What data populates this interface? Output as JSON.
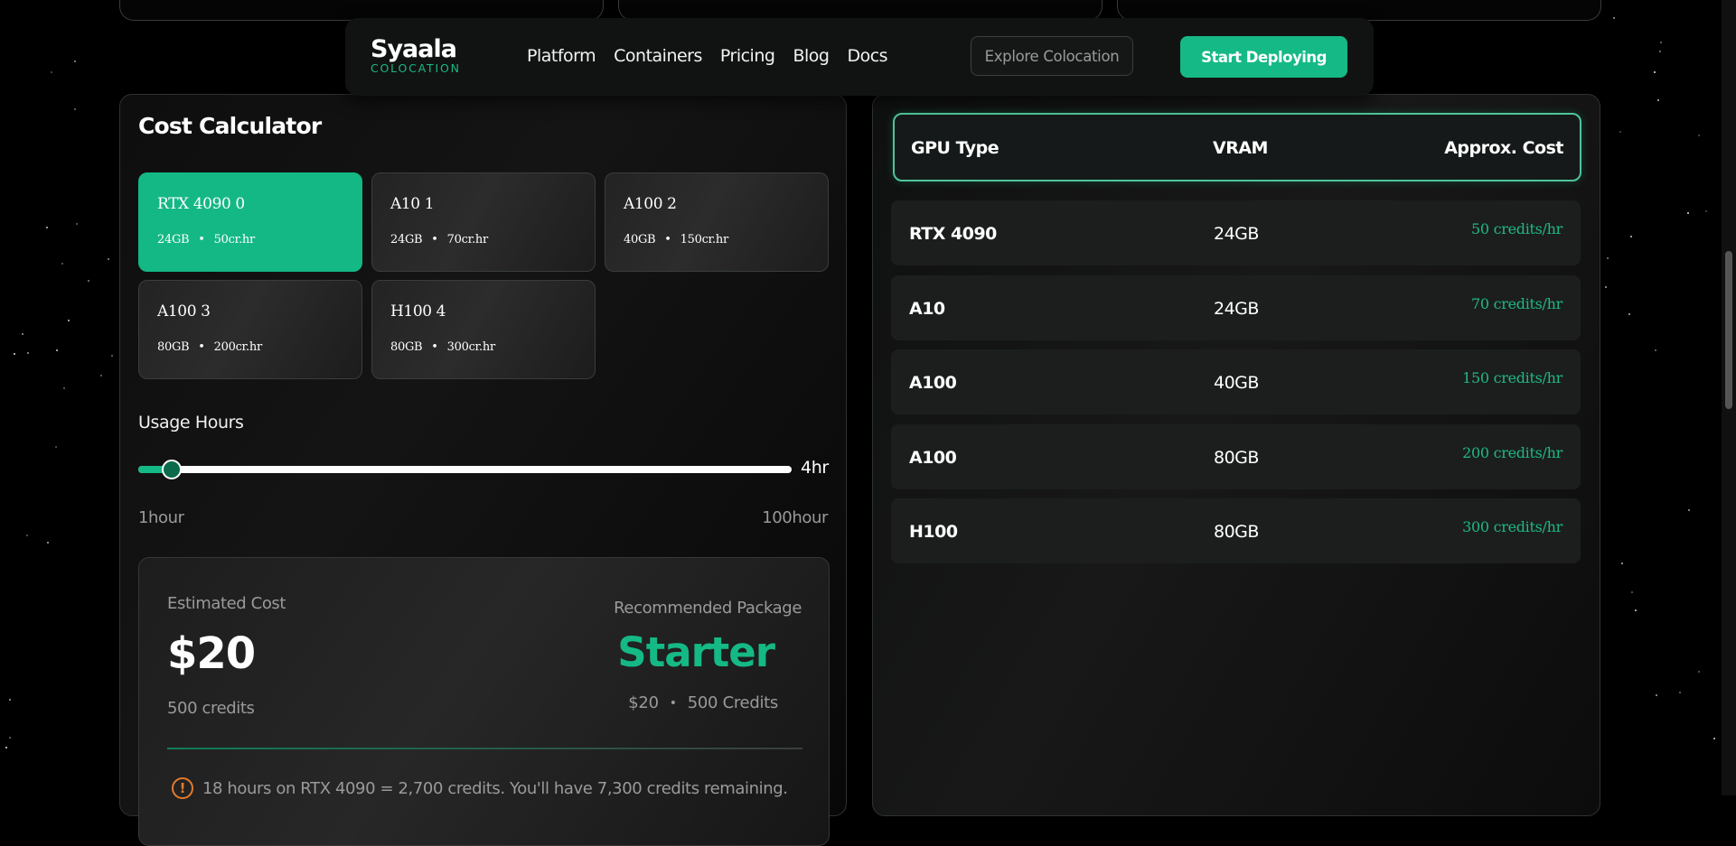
{
  "nav": {
    "logo_main": "Syaala",
    "logo_sub": "COLOCATION",
    "links": [
      "Platform",
      "Containers",
      "Pricing",
      "Blog",
      "Docs"
    ],
    "explore_label": "Explore Colocation",
    "deploy_label": "Start Deploying"
  },
  "calculator": {
    "title": "Cost Calculator",
    "gpus": [
      {
        "name": "RTX 4090 0",
        "vram": "24GB",
        "rate": "50cr.hr",
        "selected": true
      },
      {
        "name": "A10 1",
        "vram": "24GB",
        "rate": "70cr.hr",
        "selected": false
      },
      {
        "name": "A100 2",
        "vram": "40GB",
        "rate": "150cr.hr",
        "selected": false
      },
      {
        "name": "A100 3",
        "vram": "80GB",
        "rate": "200cr.hr",
        "selected": false
      },
      {
        "name": "H100 4",
        "vram": "80GB",
        "rate": "300cr.hr",
        "selected": false
      }
    ],
    "usage_label": "Usage Hours",
    "slider_value": "4hr",
    "slider_fraction": 0.05,
    "range_min": "1hour",
    "range_max": "100hour",
    "estimate": {
      "label": "Estimated Cost",
      "value": "$20",
      "credits": "500 credits",
      "rec_label": "Recommended Package",
      "rec_value": "Starter",
      "rec_price": "$20",
      "rec_credits": "500 Credits",
      "warning": "18 hours on RTX 4090 = 2,700 credits. You'll have 7,300 credits remaining."
    }
  },
  "table": {
    "headers": {
      "gpu": "GPU Type",
      "vram": "VRAM",
      "cost": "Approx. Cost"
    },
    "rows": [
      {
        "gpu": "RTX 4090",
        "vram": "24GB",
        "cost": "50 credits/hr"
      },
      {
        "gpu": "A10",
        "vram": "24GB",
        "cost": "70 credits/hr"
      },
      {
        "gpu": "A100",
        "vram": "40GB",
        "cost": "150 credits/hr"
      },
      {
        "gpu": "A100",
        "vram": "80GB",
        "cost": "200 credits/hr"
      },
      {
        "gpu": "H100",
        "vram": "80GB",
        "cost": "300 credits/hr"
      }
    ]
  },
  "colors": {
    "accent": "#15b985",
    "background": "#000000",
    "card": "#1c1e1e",
    "warning": "#e37b2b"
  }
}
